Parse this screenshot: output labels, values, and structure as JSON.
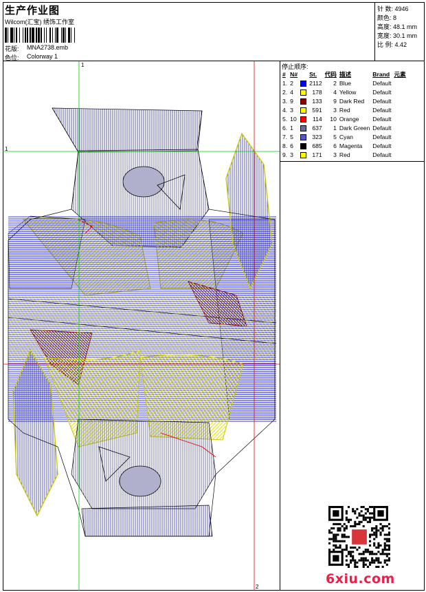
{
  "header": {
    "title": "生产作业图",
    "subtitle": "Wilcom(汇宝) 绣饰工作室",
    "design_label": "花版:",
    "design_value": "MNA2738.emb",
    "colorway_label": "色位:",
    "colorway_value": "Colorway 1"
  },
  "stats": [
    {
      "label": "针 数:",
      "value": "4946"
    },
    {
      "label": "颜色:",
      "value": "8"
    },
    {
      "label": "高度:",
      "value": "48.1 mm"
    },
    {
      "label": "宽度:",
      "value": "30.1 mm"
    },
    {
      "label": "比 例:",
      "value": "4.42"
    }
  ],
  "stop_sequence": {
    "title": "停止顺序:",
    "columns": [
      "#",
      "N#",
      "St.",
      "代码",
      "描述",
      "Brand",
      "元素"
    ],
    "rows": [
      {
        "idx": "1.",
        "n": "2",
        "color": "#0000ff",
        "st": "2112",
        "code": "2",
        "desc": "Blue",
        "brand": "Default"
      },
      {
        "idx": "2.",
        "n": "4",
        "color": "#ffff00",
        "st": "178",
        "code": "4",
        "desc": "Yellow",
        "brand": "Default"
      },
      {
        "idx": "3.",
        "n": "9",
        "color": "#8b0000",
        "st": "133",
        "code": "9",
        "desc": "Dark Red",
        "brand": "Default"
      },
      {
        "idx": "4.",
        "n": "3",
        "color": "#ffff00",
        "st": "591",
        "code": "3",
        "desc": "Red",
        "brand": "Default"
      },
      {
        "idx": "5.",
        "n": "10",
        "color": "#ff0000",
        "st": "114",
        "code": "10",
        "desc": "Orange",
        "brand": "Default"
      },
      {
        "idx": "6.",
        "n": "1",
        "color": "#6b6b99",
        "st": "637",
        "code": "1",
        "desc": "Dark Green",
        "brand": "Default"
      },
      {
        "idx": "7.",
        "n": "5",
        "color": "#5555cc",
        "st": "323",
        "code": "5",
        "desc": "Cyan",
        "brand": "Default"
      },
      {
        "idx": "8.",
        "n": "6",
        "color": "#000000",
        "st": "685",
        "code": "6",
        "desc": "Magenta",
        "brand": "Default"
      },
      {
        "idx": "9.",
        "n": "3",
        "color": "#ffff00",
        "st": "171",
        "code": "3",
        "desc": "Red",
        "brand": "Default"
      }
    ]
  },
  "guides": {
    "v1": "1",
    "h1": "1",
    "v2": "2"
  },
  "watermark": "6xiu.com"
}
